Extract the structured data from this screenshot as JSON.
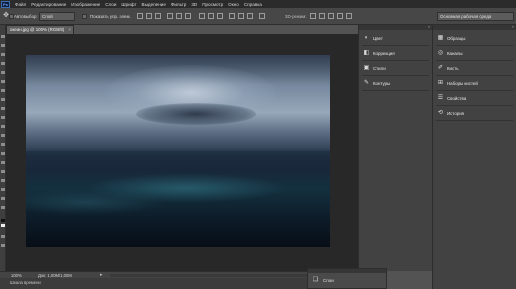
{
  "app": {
    "logo": "Ps"
  },
  "menu": {
    "items": [
      "Файл",
      "Редактирование",
      "Изображение",
      "Слои",
      "Шрифт",
      "Выделение",
      "Фильтр",
      "3D",
      "Просмотр",
      "Окно",
      "Справка"
    ]
  },
  "options": {
    "autoselect_label": "Автовыбор:",
    "autoselect_value": "Слой",
    "show_controls_label": "Показать упр. элем.",
    "mode_3d_label": "3D-режим:",
    "workspace_value": "Основная рабочая среда"
  },
  "document": {
    "tab_title": "океан.jpg @ 100% (RGB/8)",
    "zoom": "100%",
    "doc_info": "Док: 1,00M/1,00M"
  },
  "panels": {
    "column1": [
      {
        "label": "Цвет",
        "icon": "color-wheel-icon"
      },
      {
        "label": "Коррекция",
        "icon": "adjustments-icon"
      },
      {
        "label": "Стили",
        "icon": "styles-icon"
      },
      {
        "label": "Контуры",
        "icon": "paths-icon"
      }
    ],
    "column2": [
      {
        "label": "Образцы",
        "icon": "swatches-icon"
      },
      {
        "label": "Каналы",
        "icon": "channels-icon"
      },
      {
        "label": "Кисть",
        "icon": "brush-icon"
      },
      {
        "label": "Наборы кистей",
        "icon": "brush-presets-icon"
      },
      {
        "label": "Свойства",
        "icon": "properties-icon"
      },
      {
        "label": "История",
        "icon": "history-icon"
      }
    ],
    "layers": {
      "label": "Слои",
      "icon": "layers-icon"
    }
  },
  "bottom": {
    "mini_tab": "Шкала времени"
  },
  "colors": {
    "menubar": "#2b2b2b",
    "options_bar": "#474747",
    "canvas_bg": "#282828",
    "panel_bg": "#424242"
  }
}
